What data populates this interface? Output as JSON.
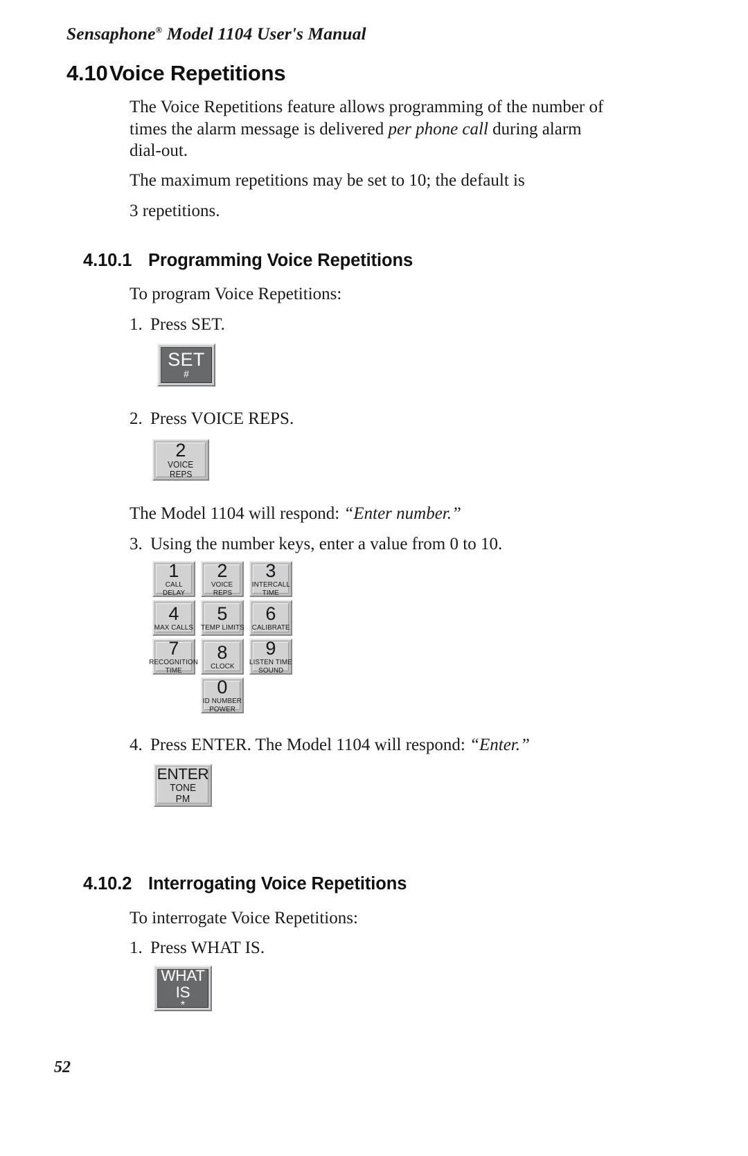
{
  "document": {
    "running_header": "Sensaphone® Model 1104 User's Manual",
    "running_header_main": "Sensaphone",
    "running_header_sup": "®",
    "running_header_rest": " Model 1104 User's Manual",
    "page_number": "52"
  },
  "section": {
    "number": "4.10",
    "title": "Voice Repetitions",
    "intro_para_1": "The Voice Repetitions feature allows programming of the number of times the alarm message is delivered ",
    "intro_para_1_italic": "per phone call",
    "intro_para_1_end": " during alarm dial-out.",
    "intro_para_2": "The maximum repetitions may be set to 10; the default is",
    "intro_para_3": "3 repetitions."
  },
  "subsection_1": {
    "number": "4.10.1",
    "title": "Programming Voice Repetitions",
    "lead_in": "To program Voice Repetitions:",
    "step_1": {
      "marker": "1.",
      "text": "Press SET."
    },
    "step_2": {
      "marker": "2.",
      "text": "Press VOICE REPS."
    },
    "response_note": "The Model 1104 will respond: ",
    "response_note_italic": "“Enter number.”",
    "step_3": {
      "marker": "3.",
      "text": "Using the number keys, enter a value from 0 to 10."
    },
    "step_4": {
      "marker": "4.",
      "text": "Press ENTER. The Model 1104 will respond: ",
      "italic": "“Enter.”"
    }
  },
  "subsection_2": {
    "number": "4.10.2",
    "title": "Interrogating Voice Repetitions",
    "lead_in": "To interrogate Voice Repetitions:",
    "step_1": {
      "marker": "1.",
      "text": "Press WHAT IS."
    }
  },
  "keys": {
    "set": {
      "main": "SET",
      "sub1": "#",
      "sub2": "",
      "style": "dark"
    },
    "voice_reps_single": {
      "main": "2",
      "sub1": "VOICE",
      "sub2": "REPS",
      "style": "light"
    },
    "enter": {
      "main": "ENTER",
      "sub1": "TONE",
      "sub2": "PM",
      "style": "light"
    },
    "what_is": {
      "main": "WHAT",
      "main2": "IS",
      "sub1": "*",
      "style": "dark"
    },
    "keypad": [
      {
        "main": "1",
        "sub1": "CALL",
        "sub2": "DELAY"
      },
      {
        "main": "2",
        "sub1": "VOICE",
        "sub2": "REPS"
      },
      {
        "main": "3",
        "sub1": "INTERCALL",
        "sub2": "TIME"
      },
      {
        "main": "4",
        "sub1": "MAX CALLS",
        "sub2": ""
      },
      {
        "main": "5",
        "sub1": "TEMP LIMITS",
        "sub2": ""
      },
      {
        "main": "6",
        "sub1": "CALIBRATE",
        "sub2": ""
      },
      {
        "main": "7",
        "sub1": "RECOGNITION",
        "sub2": "TIME"
      },
      {
        "main": "8",
        "sub1": "CLOCK",
        "sub2": ""
      },
      {
        "main": "9",
        "sub1": "LISTEN TIME",
        "sub2": "SOUND"
      },
      {
        "main": "0",
        "sub1": "ID NUMBER",
        "sub2": "POWER"
      }
    ]
  },
  "colors": {
    "page_background": "#ffffff",
    "text": "#1a1a1a",
    "key_dark_face": "#67696b",
    "key_light_face": "#d2d2d2",
    "key_frame": "#c9c9c9"
  }
}
